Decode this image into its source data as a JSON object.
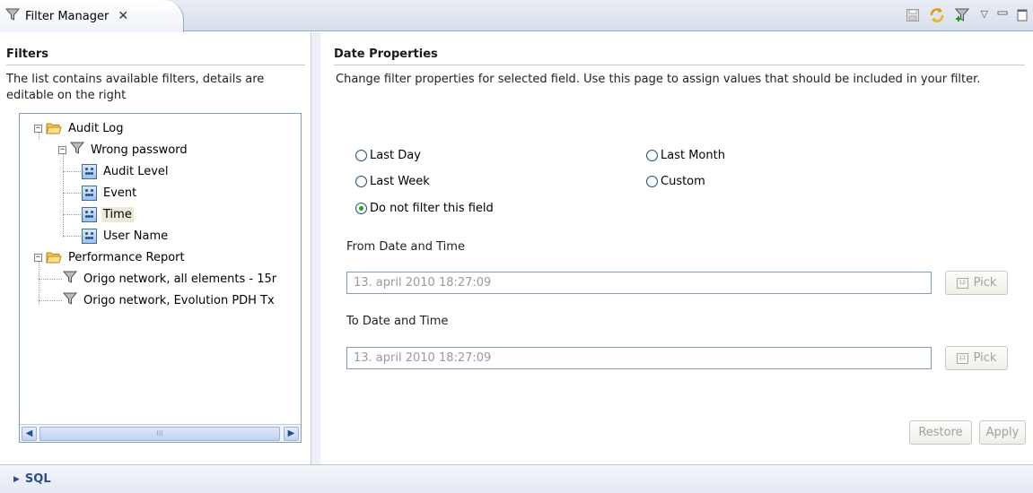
{
  "tab": {
    "title": "Filter Manager",
    "close_glyph": "✕",
    "icon": "funnel-icon"
  },
  "toolbar": {
    "icons": [
      "save-icon",
      "refresh-icon",
      "new-filter-icon",
      "view-menu-icon",
      "minimize-icon",
      "maximize-icon"
    ],
    "view_menu_glyph": "▽"
  },
  "filters": {
    "title": "Filters",
    "description_line1": "The list contains available filters, details are",
    "description_line2": "editable on the right",
    "tree": [
      {
        "label": "Audit Log",
        "kind": "folder",
        "level": 0,
        "expanded": true
      },
      {
        "label": "Wrong password",
        "kind": "filter",
        "level": 1,
        "expanded": true
      },
      {
        "label": "Audit Level",
        "kind": "field",
        "level": 2
      },
      {
        "label": "Event",
        "kind": "field",
        "level": 2
      },
      {
        "label": "Time",
        "kind": "field",
        "level": 2,
        "selected": true
      },
      {
        "label": "User Name",
        "kind": "field",
        "level": 2
      },
      {
        "label": "Performance Report",
        "kind": "folder",
        "level": 0,
        "expanded": true
      },
      {
        "label": "Origo network, all elements - 15r",
        "kind": "filter",
        "level": 1
      },
      {
        "label": "Origo network, Evolution PDH Tx",
        "kind": "filter",
        "level": 1
      }
    ],
    "scroll_thumb_glyph": "III"
  },
  "date_properties": {
    "title": "Date Properties",
    "description": "Change filter properties for selected field. Use this page to assign values that should be included in your filter.",
    "options": {
      "last_day": "Last Day",
      "last_week": "Last Week",
      "do_not_filter": "Do not filter this field",
      "last_month": "Last Month",
      "custom": "Custom"
    },
    "selected_option": "do_not_filter",
    "from_label": "From Date and Time",
    "from_value": "13. april 2010 18:27:09",
    "to_label": "To Date and Time",
    "to_value": "13. april 2010 18:27:09",
    "pick_label": "Pick",
    "calendar_glyph": "12",
    "restore_label": "Restore",
    "apply_label": "Apply"
  },
  "bottom": {
    "sql_label": "SQL",
    "arrow_glyph": "▶"
  }
}
